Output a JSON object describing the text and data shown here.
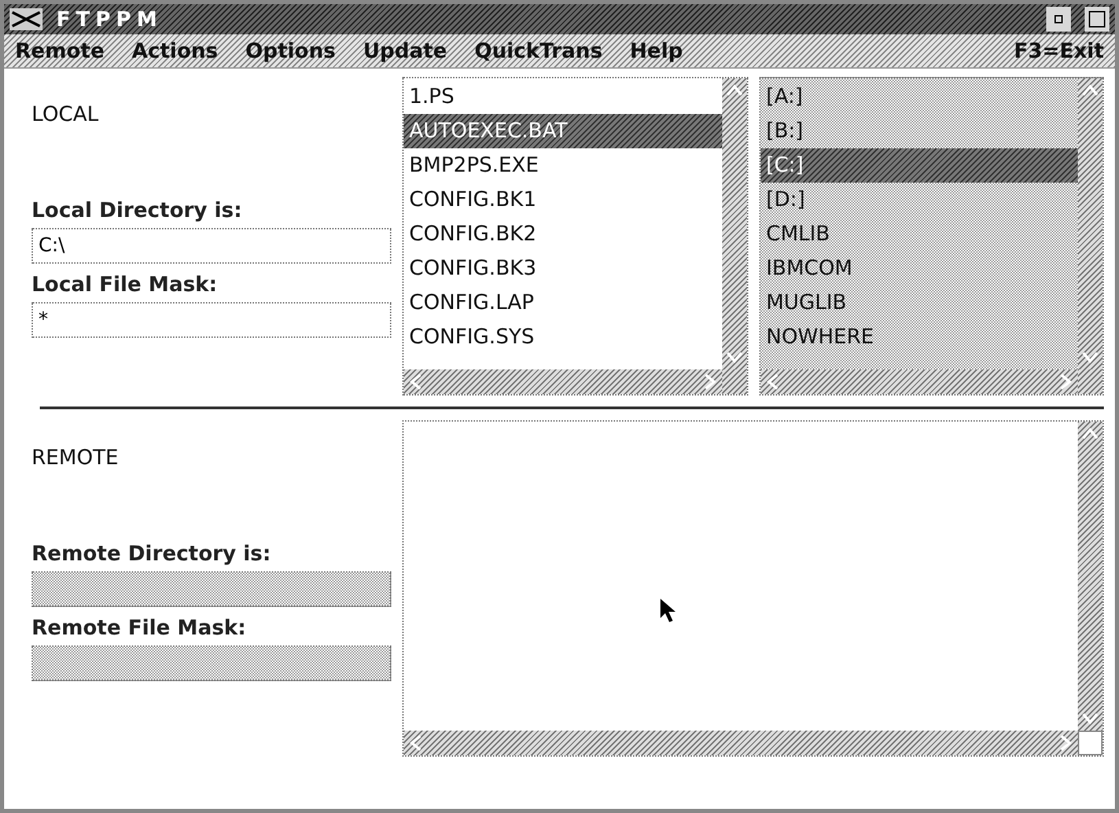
{
  "window": {
    "title": "FTPPM"
  },
  "menu": [
    {
      "label": "Remote"
    },
    {
      "label": "Actions"
    },
    {
      "label": "Options"
    },
    {
      "label": "Update"
    },
    {
      "label": "QuickTrans"
    },
    {
      "label": "Help"
    }
  ],
  "menu_right": "F3=Exit",
  "local": {
    "heading": "LOCAL",
    "directory_label": "Local Directory is:",
    "directory": {
      "value": "C:\\",
      "disabled": false
    },
    "mask_label": "Local File Mask:",
    "mask": {
      "value": "*",
      "disabled": false
    },
    "files": [
      {
        "name": "1.PS",
        "selected": false
      },
      {
        "name": "AUTOEXEC.BAT",
        "selected": true
      },
      {
        "name": "BMP2PS.EXE",
        "selected": false
      },
      {
        "name": "CONFIG.BK1",
        "selected": false
      },
      {
        "name": "CONFIG.BK2",
        "selected": false
      },
      {
        "name": "CONFIG.BK3",
        "selected": false
      },
      {
        "name": "CONFIG.LAP",
        "selected": false
      },
      {
        "name": "CONFIG.SYS",
        "selected": false
      }
    ],
    "directories": [
      {
        "name": "[A:]",
        "selected": false
      },
      {
        "name": "[B:]",
        "selected": false
      },
      {
        "name": "[C:]",
        "selected": true
      },
      {
        "name": "[D:]",
        "selected": false
      },
      {
        "name": "CMLIB",
        "selected": false
      },
      {
        "name": "IBMCOM",
        "selected": false
      },
      {
        "name": "MUGLIB",
        "selected": false
      },
      {
        "name": "NOWHERE",
        "selected": false
      }
    ]
  },
  "remote": {
    "heading": "REMOTE",
    "directory_label": "Remote Directory is:",
    "directory": {
      "disabled": true
    },
    "mask_label": "Remote File Mask:",
    "mask": {
      "disabled": true
    }
  }
}
